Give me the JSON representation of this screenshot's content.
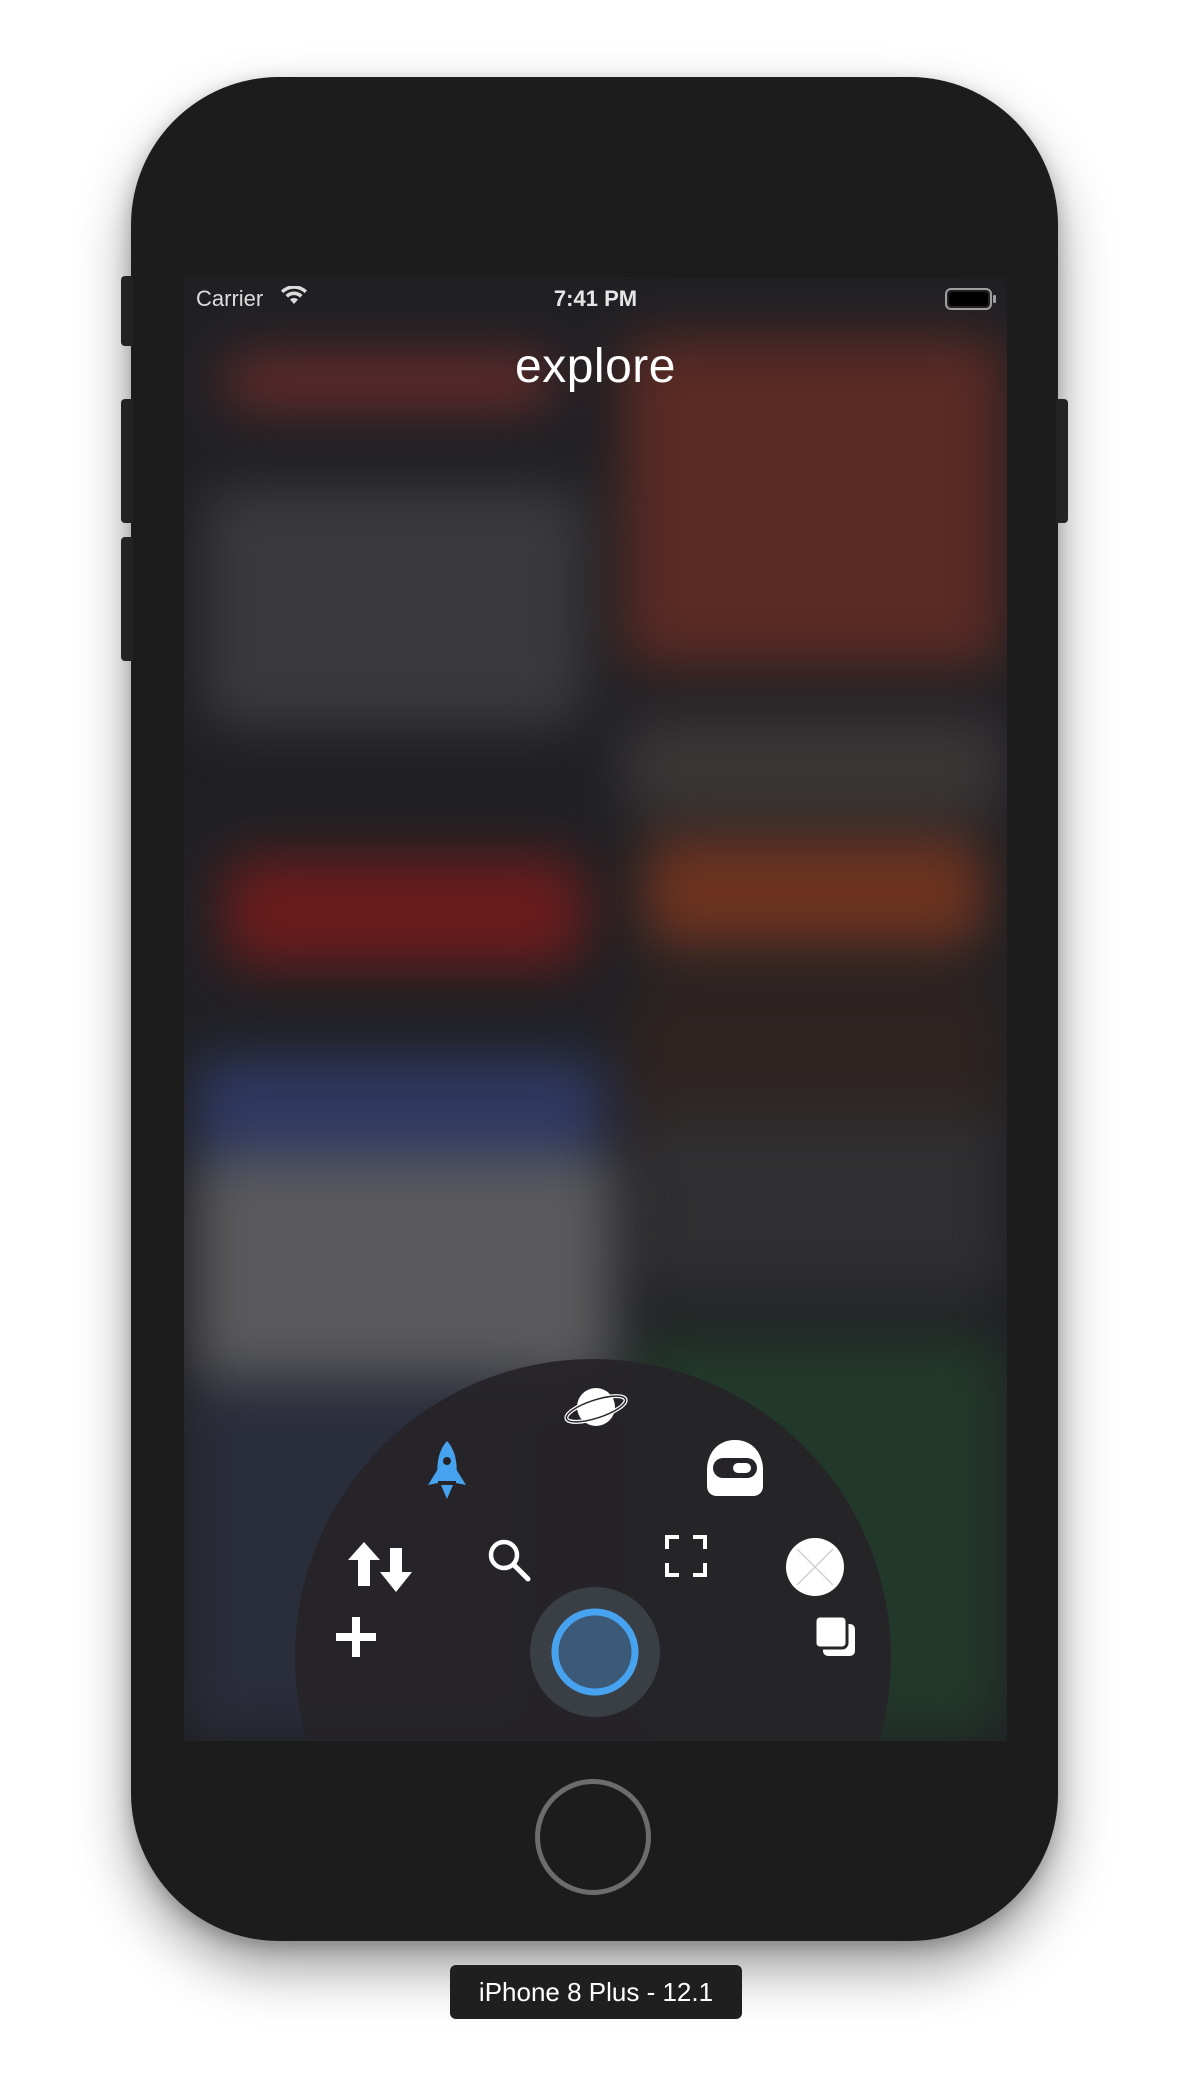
{
  "status_bar": {
    "carrier": "Carrier",
    "time": "7:41 PM",
    "wifi_icon": "wifi-icon",
    "battery_icon": "battery-icon"
  },
  "header": {
    "title": "explore"
  },
  "radial_menu": {
    "items": [
      {
        "name": "planet",
        "icon": "planet-icon"
      },
      {
        "name": "rocket",
        "icon": "rocket-icon",
        "selected": true
      },
      {
        "name": "astronaut-helmet",
        "icon": "helmet-icon"
      },
      {
        "name": "sort",
        "icon": "sort-arrows-icon"
      },
      {
        "name": "search",
        "icon": "search-icon"
      },
      {
        "name": "expand",
        "icon": "expand-frame-icon"
      },
      {
        "name": "close",
        "icon": "close-circle-icon"
      },
      {
        "name": "add",
        "icon": "plus-icon"
      },
      {
        "name": "center-toggle",
        "icon": "ring-button-icon"
      },
      {
        "name": "layers",
        "icon": "copy-layers-icon"
      }
    ],
    "accent_color": "#47a3ef"
  },
  "device_label": "iPhone 8 Plus - 12.1"
}
